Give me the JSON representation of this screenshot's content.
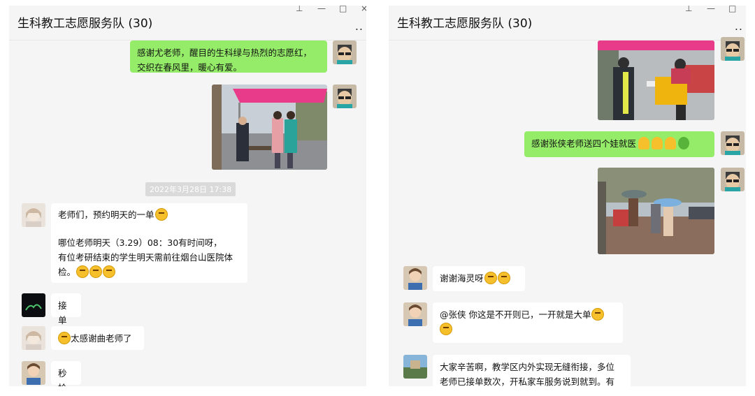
{
  "left": {
    "title": "生科教工志愿服务队 (30)",
    "ctrl": {
      "pin": "⊥",
      "min": "—",
      "max": "□",
      "close": "×"
    },
    "more": "..",
    "msg1": {
      "line1": "感谢尤老师，醒目的生科绿与热烈的志愿红，",
      "line2": "交织在春风里，暖心有爱。"
    },
    "timestamp": "2022年3月28日 17:38",
    "msg2": {
      "line1": "老师们，预约明天的一单",
      "line2": "哪位老师明天（3.29）08：30有时间呀，",
      "line3": "有位考研结束的学生明天需前往烟台山医院体",
      "line4": "检。"
    },
    "msg3": "接单",
    "msg4": "太感谢曲老师了",
    "msg5": "秒抢"
  },
  "right": {
    "title": "生科教工志愿服务队 (30)",
    "ctrl": {
      "pin": "⊥",
      "min": "—",
      "max": "□"
    },
    "more": "..",
    "msg1": "感谢张侠老师送四个娃就医",
    "msg2": "谢谢海灵呀",
    "msg3": "@张侠 你这是不开则已，一开就是大单",
    "msg4": {
      "line1": "大家辛苦啊，教学区内外实现无缝衔接，多位",
      "line2": "老师已接单数次，开私家车服务说到就到。有"
    }
  },
  "colors": {
    "self_bubble": "#95ec69",
    "other_bubble": "#ffffff",
    "panel_bg": "#f5f5f5"
  }
}
